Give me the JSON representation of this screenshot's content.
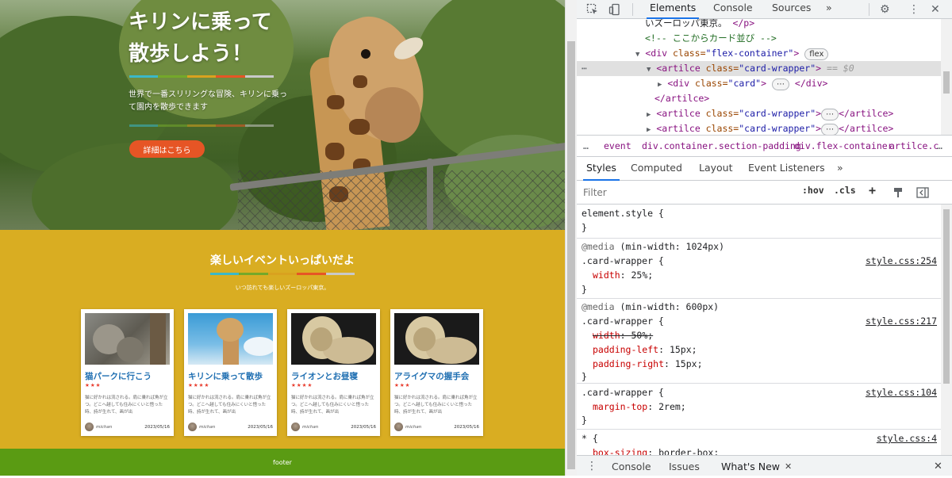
{
  "hero": {
    "title_line1": "キリンに乗って",
    "title_line2": "散歩しよう！",
    "description": "世界で一番スリリングな冒険、キリンに乗って園内を散歩できます",
    "button_label": "詳細はこちら",
    "rainbow_colors": [
      "#3bb8c8",
      "#74a82a",
      "#d9a21f",
      "#e65525",
      "#c9c9c9"
    ]
  },
  "events": {
    "title": "楽しいイベントいっぱいだよ",
    "subtitle": "いつ訪れても楽しいズーロッパ東京。",
    "cards": [
      {
        "title": "猫パークに行こう",
        "stars": "★★★",
        "text": "猫に好かれは流される。肩に乗れば角が立つ。どこへ越しても住みにくいと悟った時、詩が生れて、画が出",
        "user": "michan",
        "date": "2023/05/16",
        "image": "cats"
      },
      {
        "title": "キリンに乗って散歩",
        "stars": "★★★★",
        "text": "猫に好かれは流される。肩に乗れば角が立つ。どこへ越しても住みにくいと悟った時、詩が生れて、画が出",
        "user": "michan",
        "date": "2023/05/16",
        "image": "giraffe"
      },
      {
        "title": "ライオンとお昼寝",
        "stars": "★★★★",
        "text": "猫に好かれは流される。肩に乗れば角が立つ。どこへ越しても住みにくいと悟った時、詩が生れて、画が出",
        "user": "michan",
        "date": "2023/05/16",
        "image": "lion"
      },
      {
        "title": "アライグマの握手会",
        "stars": "★★★",
        "text": "猫に好かれは流される。肩に乗れば角が立つ。どこへ越しても住みにくいと悟った時、詩が生れて、画が出",
        "user": "michan",
        "date": "2023/05/16",
        "image": "lion"
      }
    ]
  },
  "footer": {
    "label": "footer"
  },
  "devtools": {
    "tabs": [
      "Elements",
      "Console",
      "Sources"
    ],
    "more_tabs": "»",
    "dom_lines": {
      "l1_text": "いズーロッパ東京。",
      "l1_close": "</p>",
      "l2_comment": "<!-- ここからカード並び -->",
      "l3_open": "<div ",
      "l3_attr": "class=",
      "l3_val": "\"flex-container\"",
      "l3_close": ">",
      "l3_pill": "flex",
      "l4_open": "<artilce ",
      "l4_attr": "class=",
      "l4_val": "\"card-wrapper\"",
      "l4_close": ">",
      "l4_eq": "== $0",
      "l5_open": "<div ",
      "l5_attr": "class=",
      "l5_val": "\"card\"",
      "l5_close": ">",
      "l5_pill": "⋯",
      "l5_end": "</div>",
      "l6": "</artilce>",
      "l7_open": "<artilce ",
      "l7_attr": "class=",
      "l7_val": "\"card-wrapper\"",
      "l7_close": ">",
      "l7_pill": "⋯",
      "l7_end": "</artilce>"
    },
    "breadcrumb": [
      "…",
      "event",
      "div.container.section-padding",
      "div.flex-container",
      "artilce.c",
      "…"
    ],
    "styles_tabs": [
      "Styles",
      "Computed",
      "Layout",
      "Event Listeners",
      "»"
    ],
    "filter_placeholder": "Filter",
    "filter_buttons": [
      ":hov",
      ".cls",
      "+"
    ],
    "rules": {
      "element_style": "element.style {",
      "close": "}",
      "r1_media": "@media",
      "r1_cond": " (min-width: 1024px)",
      "r1_selector": ".card-wrapper {",
      "r1_src": "style.css:254",
      "r1_p1": "width",
      "r1_v1": "25%;",
      "r2_media": "@media",
      "r2_cond": " (min-width: 600px)",
      "r2_selector": ".card-wrapper {",
      "r2_src": "style.css:217",
      "r2_p1": "width",
      "r2_v1": "50%;",
      "r2_p2": "padding-left",
      "r2_v2": "15px;",
      "r2_p3": "padding-right",
      "r2_v3": "15px;",
      "r3_selector": ".card-wrapper {",
      "r3_src": "style.css:104",
      "r3_p1": "margin-top",
      "r3_v1": "2rem;",
      "r4_selector": "* {",
      "r4_src": "style.css:4",
      "r4_p1": "box-sizing",
      "r4_v1": "border-box;"
    },
    "drawer": {
      "console": "Console",
      "issues": "Issues",
      "whats_new": "What's New",
      "close": "✕"
    }
  }
}
